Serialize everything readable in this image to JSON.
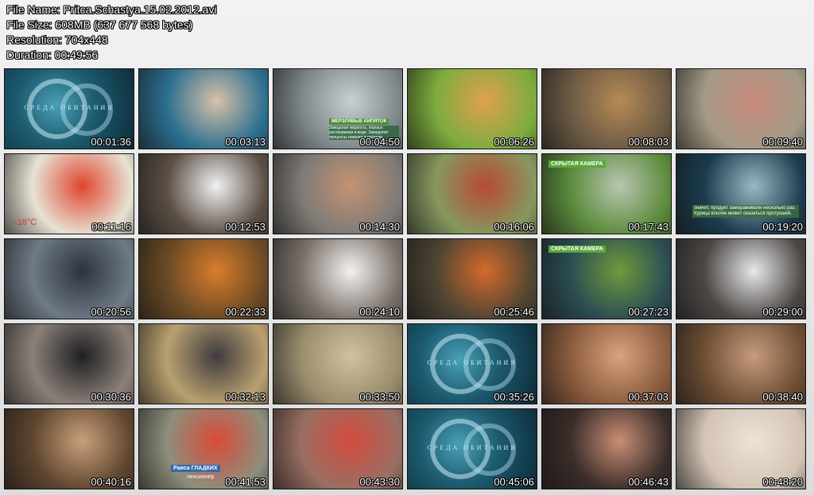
{
  "header": {
    "file_name": "File Name: Pritca.Schastya.15.02.2012.avi",
    "file_size": "File Size: 608MB (637 677 568 bytes)",
    "resolution": "Resolution: 704x448",
    "duration": "Duration: 00:49:56"
  },
  "thumbnails": [
    {
      "time": "00:01:36",
      "scene": "title-logo",
      "bg": "#1c5a6e",
      "accent": "#7fc4d6",
      "text": "СРЕДА ОБИТАНИЯ"
    },
    {
      "time": "00:03:13",
      "scene": "man-aquarium",
      "bg": "#2c6f90",
      "accent": "#d8c1a8"
    },
    {
      "time": "00:04:50",
      "scene": "ice-water",
      "bg": "#7d8589",
      "accent": "#c9d0d2",
      "tag": "МЕРЗЛЯВЫЕ КИПЯТОК",
      "caption": "Заводская жидкость, хорошо растворимая в воде. Замедляет процессы гниения и распада."
    },
    {
      "time": "00:06:26",
      "scene": "fried-cutlets",
      "bg": "#7dac3e",
      "accent": "#e0a04e"
    },
    {
      "time": "00:08:03",
      "scene": "cage-fox",
      "bg": "#6b5a44",
      "accent": "#b78a55"
    },
    {
      "time": "00:09:40",
      "scene": "meat-trays",
      "bg": "#a49a86",
      "accent": "#c88b7d"
    },
    {
      "time": "00:11:16",
      "scene": "labels-package",
      "bg": "#e7e2d4",
      "accent": "#e0452f",
      "text": "-18°C"
    },
    {
      "time": "00:12:53",
      "scene": "chef-kitchen",
      "bg": "#5b4f45",
      "accent": "#f1f1f1"
    },
    {
      "time": "00:14:30",
      "scene": "two-women-street",
      "bg": "#7e7a76",
      "accent": "#c49372"
    },
    {
      "time": "00:16:06",
      "scene": "playground",
      "bg": "#86985f",
      "accent": "#b84a34"
    },
    {
      "time": "00:17:43",
      "scene": "hidden-camera",
      "bg": "#5b8b3c",
      "accent": "#b9c6b0",
      "tag": "СКРЫТАЯ КАМЕРА"
    },
    {
      "time": "00:19:20",
      "scene": "graphic-plate",
      "bg": "#1b3c4e",
      "accent": "#9bb9c4",
      "caption": "значит, продукт замораживали несколько раз. Курица вполне может оказаться протухшей."
    },
    {
      "time": "00:20:56",
      "scene": "police-officer",
      "bg": "#6e7a86",
      "accent": "#2d3340"
    },
    {
      "time": "00:22:33",
      "scene": "roast-chicken",
      "bg": "#6a4a25",
      "accent": "#d97d2b"
    },
    {
      "time": "00:24:10",
      "scene": "chef-cooking",
      "bg": "#7a7068",
      "accent": "#f2f2f2"
    },
    {
      "time": "00:25:46",
      "scene": "food-tray",
      "bg": "#4d4433",
      "accent": "#d46a2b"
    },
    {
      "time": "00:27:23",
      "scene": "hidden-camera-2",
      "bg": "#2b4c53",
      "accent": "#6f9a3c",
      "tag": "СКРЫТАЯ КАМЕРА"
    },
    {
      "time": "00:29:00",
      "scene": "man-drawing",
      "bg": "#4c4846",
      "accent": "#e8e8e8"
    },
    {
      "time": "00:30:36",
      "scene": "woman-snow",
      "bg": "#8b8078",
      "accent": "#1f1f22"
    },
    {
      "time": "00:32:13",
      "scene": "man-map",
      "bg": "#b9a06f",
      "accent": "#3f3b40"
    },
    {
      "time": "00:33:50",
      "scene": "bird-closeup",
      "bg": "#9a8d6e",
      "accent": "#cfc2a2"
    },
    {
      "time": "00:35:26",
      "scene": "title-logo-2",
      "bg": "#1c5a6e",
      "accent": "#7fc4d6",
      "text": "СРЕДА ОБИТАНИЯ"
    },
    {
      "time": "00:37:03",
      "scene": "raw-meat",
      "bg": "#8a5b3d",
      "accent": "#d9a37e"
    },
    {
      "time": "00:38:40",
      "scene": "men-table",
      "bg": "#6d4e34",
      "accent": "#c79b7e"
    },
    {
      "time": "00:40:16",
      "scene": "group-dinner",
      "bg": "#5e4530",
      "accent": "#c9a079"
    },
    {
      "time": "00:41:53",
      "scene": "woman-kitchen",
      "bg": "#8e8e7c",
      "accent": "#d94b38",
      "tag": "Раиса ГЛАДКИХ",
      "caption": "пенсионер"
    },
    {
      "time": "00:43:30",
      "scene": "market-stall",
      "bg": "#9a6f63",
      "accent": "#d24b3e"
    },
    {
      "time": "00:45:06",
      "scene": "title-logo-3",
      "bg": "#1c5a6e",
      "accent": "#7fc4d6",
      "text": "СРЕДА ОБИТАНИЯ"
    },
    {
      "time": "00:46:43",
      "scene": "man-woman-dinner",
      "bg": "#3a2d2a",
      "accent": "#c98e74"
    },
    {
      "time": "00:48:20",
      "scene": "hand-dough",
      "bg": "#d3c4b4",
      "accent": "#eee2d6"
    }
  ]
}
